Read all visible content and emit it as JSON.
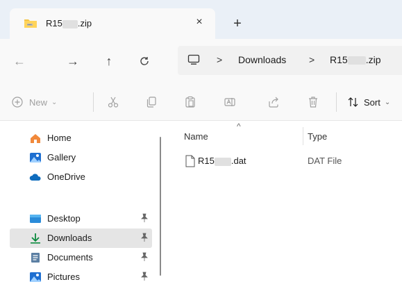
{
  "tab": {
    "title_prefix": "R15",
    "title_suffix": ".zip",
    "close_glyph": "×",
    "new_tab_glyph": "+",
    "icon": "zip-folder-icon"
  },
  "nav": {
    "back_glyph": "←",
    "forward_glyph": "→",
    "up_glyph": "↑",
    "refresh_glyph": "C"
  },
  "address": {
    "icon": "this-pc-icon",
    "separator": ">",
    "crumbs": [
      "Downloads",
      "R15",
      ".zip"
    ]
  },
  "toolbar": {
    "new_label": "New",
    "sort_label": "Sort",
    "icons": [
      "new-icon",
      "cut-icon",
      "copy-icon",
      "paste-icon",
      "rename-icon",
      "share-icon",
      "delete-icon",
      "sort-icon"
    ]
  },
  "sidebar": {
    "items": [
      {
        "label": "Home",
        "icon": "home-icon",
        "pinned": false
      },
      {
        "label": "Gallery",
        "icon": "gallery-icon",
        "pinned": false
      },
      {
        "label": "OneDrive",
        "icon": "onedrive-icon",
        "pinned": false
      },
      {
        "label": "Desktop",
        "icon": "desktop-icon",
        "pinned": true
      },
      {
        "label": "Downloads",
        "icon": "downloads-icon",
        "pinned": true,
        "selected": true
      },
      {
        "label": "Documents",
        "icon": "documents-icon",
        "pinned": true
      },
      {
        "label": "Pictures",
        "icon": "pictures-icon",
        "pinned": true
      }
    ]
  },
  "files": {
    "columns": [
      "Name",
      "Type"
    ],
    "rows": [
      {
        "name_prefix": "R15",
        "name_suffix": ".dat",
        "type": "DAT File"
      }
    ]
  },
  "colors": {
    "tabstrip_bg": "#eaf0f7",
    "selected_bg": "#e5e5e5",
    "accent": "#0067c0",
    "folder_yellow": "#f4c343"
  }
}
